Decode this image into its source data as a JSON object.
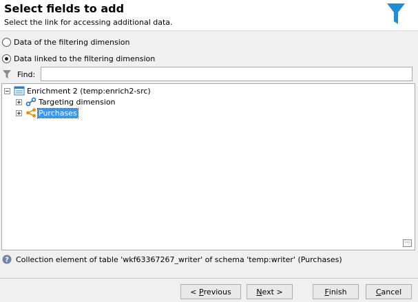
{
  "header": {
    "title": "Select fields to add",
    "subtitle": "Select the link for accessing additional data."
  },
  "options": {
    "filtering_dimension_label": "Data of the filtering dimension",
    "linked_dimension_label": "Data linked to the filtering dimension",
    "selected": "linked"
  },
  "find": {
    "label": "Find:",
    "value": ""
  },
  "tree": {
    "root": {
      "label": "Enrichment 2 (temp:enrich2-src)",
      "expanded": true
    },
    "children": [
      {
        "label": "Targeting dimension",
        "icon": "link-icon",
        "expanded": false,
        "selected": false
      },
      {
        "label": "Purchases",
        "icon": "collection-link-icon",
        "expanded": false,
        "selected": true
      }
    ]
  },
  "info": {
    "text": "Collection element of table 'wkf63367267_writer' of schema 'temp:writer' (Purchases)"
  },
  "buttons": {
    "previous": {
      "prefix": "< ",
      "accel": "P",
      "rest": "revious"
    },
    "next": {
      "accel": "N",
      "rest": "ext >"
    },
    "finish": {
      "accel": "F",
      "rest": "inish"
    },
    "cancel": {
      "accel": "C",
      "rest": "ancel"
    }
  },
  "colors": {
    "accent_blue": "#1e8fd6",
    "selection": "#3399ff",
    "collection_orange": "#f08c00"
  }
}
